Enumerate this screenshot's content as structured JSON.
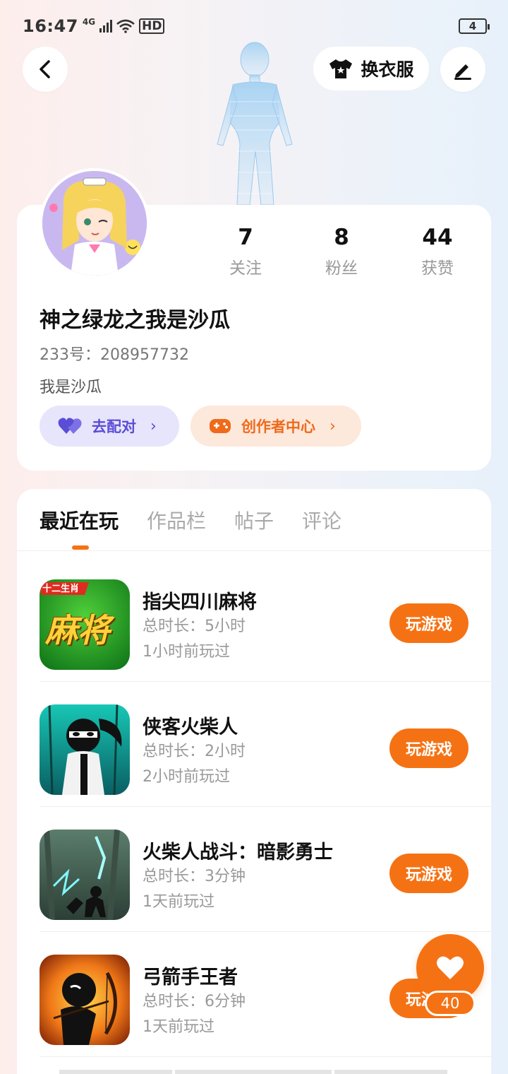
{
  "status_bar": {
    "time": "16:47",
    "network": "4G",
    "hd": "HD",
    "battery": "4"
  },
  "header": {
    "outfit_label": "换衣服"
  },
  "profile": {
    "nickname": "神之绿龙之我是沙瓜",
    "uid": "233号：208957732",
    "bio": "我是沙瓜",
    "stats": [
      {
        "value": "7",
        "label": "关注"
      },
      {
        "value": "8",
        "label": "粉丝"
      },
      {
        "value": "44",
        "label": "获赞"
      }
    ],
    "match_label": "去配对",
    "creator_label": "创作者中心"
  },
  "tabs": [
    {
      "label": "最近在玩"
    },
    {
      "label": "作品栏"
    },
    {
      "label": "帖子"
    },
    {
      "label": "评论"
    }
  ],
  "games": [
    {
      "title": "指尖四川麻将",
      "duration": "总时长：5小时",
      "last_played": "1小时前玩过",
      "icon": "mahjong-icon",
      "icon_text": "麻将",
      "icon_badge": "十二生肖",
      "play_label": "玩游戏"
    },
    {
      "title": "侠客火柴人",
      "duration": "总时长：2小时",
      "last_played": "2小时前玩过",
      "icon": "ninja-icon",
      "play_label": "玩游戏"
    },
    {
      "title": "火柴人战斗：暗影勇士",
      "duration": "总时长：3分钟",
      "last_played": "1天前玩过",
      "icon": "shadow-warrior-icon",
      "play_label": "玩游戏"
    },
    {
      "title": "弓箭手王者",
      "duration": "总时长：6分钟",
      "last_played": "1天前玩过",
      "icon": "archer-icon",
      "play_label": "玩游戏"
    }
  ],
  "like_fab": {
    "count": "40"
  },
  "colors": {
    "accent": "#f57214",
    "match": "#5b4dd6",
    "match_bg": "#e7e5fb",
    "creator_bg": "#fde8dc"
  }
}
